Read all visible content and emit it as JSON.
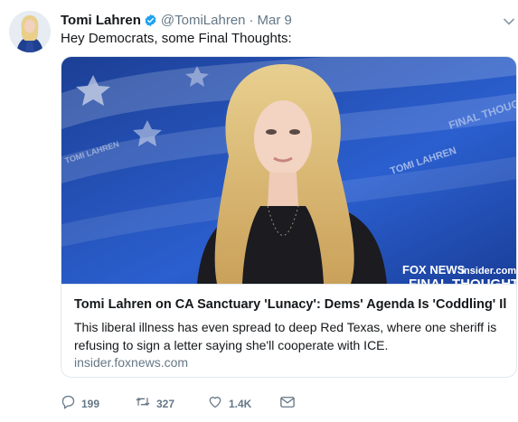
{
  "tweet": {
    "author_name": "Tomi Lahren",
    "handle": "@TomiLahren",
    "separator": "·",
    "date": "Mar 9",
    "text": "Hey Democrats, some Final Thoughts:",
    "verified": true
  },
  "card": {
    "title": "Tomi Lahren on CA Sanctuary 'Lunacy': Dems' Agenda Is 'Coddling' Il...",
    "description": "This liberal illness has even spread to deep Red Texas, where one sheriff is refusing to sign a letter saying she'll cooperate with ICE.",
    "domain": "insider.foxnews.com",
    "image_watermark": {
      "brand": "FOX NEWS",
      "site": "insider.com/",
      "banner": "FINAL THOUGHTS",
      "background_text": [
        "TOMI LAHREN",
        "FINAL THOUGHTS"
      ]
    }
  },
  "actions": {
    "replies": "199",
    "retweets": "327",
    "likes": "1.4K"
  },
  "icons": {
    "verified": "verified-badge-icon",
    "caret": "chevron-down-icon",
    "reply": "reply-icon",
    "retweet": "retweet-icon",
    "like": "heart-icon",
    "dm": "envelope-icon"
  },
  "colors": {
    "verified": "#1da1f2",
    "muted": "#657786",
    "text": "#14171a",
    "border": "#e1e8ed"
  }
}
